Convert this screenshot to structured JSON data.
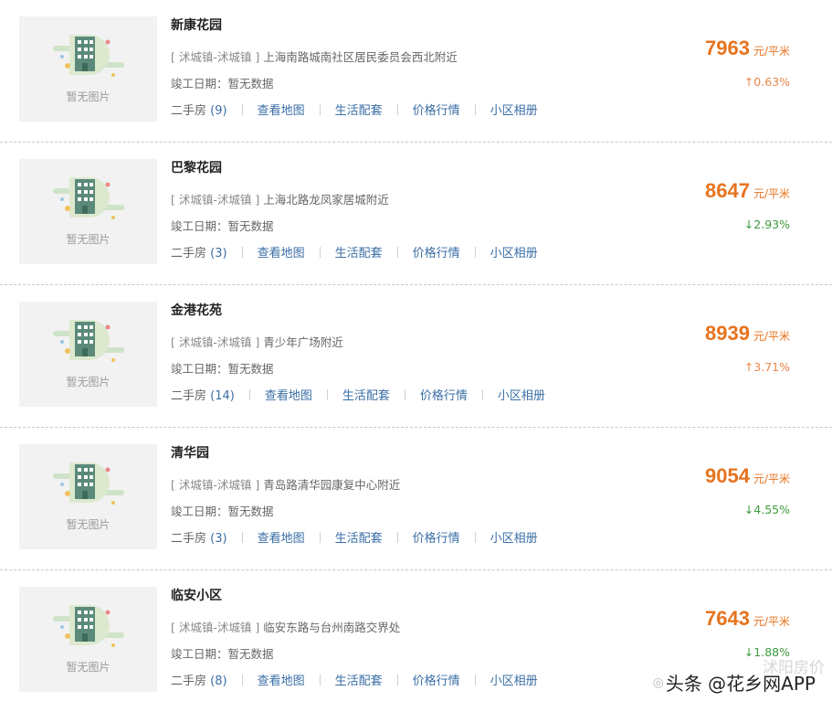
{
  "communities": [
    {
      "name": "新康花园",
      "district": "[ 沭城镇-沭城镇 ]",
      "address": "上海南路城南社区居民委员会西北附近",
      "completion_label": "竣工日期：暂无数据",
      "second_hand_label": "二手房",
      "second_hand_count": "(9)",
      "map_link": "查看地图",
      "amenities_link": "生活配套",
      "price_trend_link": "价格行情",
      "album_link": "小区相册",
      "price": "7963",
      "price_unit": "元/平米",
      "change": "↑0.63%",
      "trend": "up"
    },
    {
      "name": "巴黎花园",
      "district": "[ 沭城镇-沭城镇 ]",
      "address": "上海北路龙凤家居城附近",
      "completion_label": "竣工日期：暂无数据",
      "second_hand_label": "二手房",
      "second_hand_count": "(3)",
      "map_link": "查看地图",
      "amenities_link": "生活配套",
      "price_trend_link": "价格行情",
      "album_link": "小区相册",
      "price": "8647",
      "price_unit": "元/平米",
      "change": "↓2.93%",
      "trend": "down"
    },
    {
      "name": "金港花苑",
      "district": "[ 沭城镇-沭城镇 ]",
      "address": "青少年广场附近",
      "completion_label": "竣工日期：暂无数据",
      "second_hand_label": "二手房",
      "second_hand_count": "(14)",
      "map_link": "查看地图",
      "amenities_link": "生活配套",
      "price_trend_link": "价格行情",
      "album_link": "小区相册",
      "price": "8939",
      "price_unit": "元/平米",
      "change": "↑3.71%",
      "trend": "up"
    },
    {
      "name": "清华园",
      "district": "[ 沭城镇-沭城镇 ]",
      "address": "青岛路清华园康复中心附近",
      "completion_label": "竣工日期：暂无数据",
      "second_hand_label": "二手房",
      "second_hand_count": "(3)",
      "map_link": "查看地图",
      "amenities_link": "生活配套",
      "price_trend_link": "价格行情",
      "album_link": "小区相册",
      "price": "9054",
      "price_unit": "元/平米",
      "change": "↓4.55%",
      "trend": "down"
    },
    {
      "name": "临安小区",
      "district": "[ 沭城镇-沭城镇 ]",
      "address": "临安东路与台州南路交界处",
      "completion_label": "竣工日期：暂无数据",
      "second_hand_label": "二手房",
      "second_hand_count": "(8)",
      "map_link": "查看地图",
      "amenities_link": "生活配套",
      "price_trend_link": "价格行情",
      "album_link": "小区相册",
      "price": "7643",
      "price_unit": "元/平米",
      "change": "↓1.88%",
      "trend": "down"
    }
  ],
  "placeholder_text": "暂无图片",
  "watermark": "头条 @花乡网APP",
  "watermark_faded": "沭阳房价",
  "colors": {
    "price": "#e6731e",
    "up": "#e8874a",
    "down": "#3e9a3e",
    "link": "#3a6ea5"
  },
  "icons": {
    "placeholder": "house-placeholder-icon",
    "wechat": "wechat-icon"
  }
}
